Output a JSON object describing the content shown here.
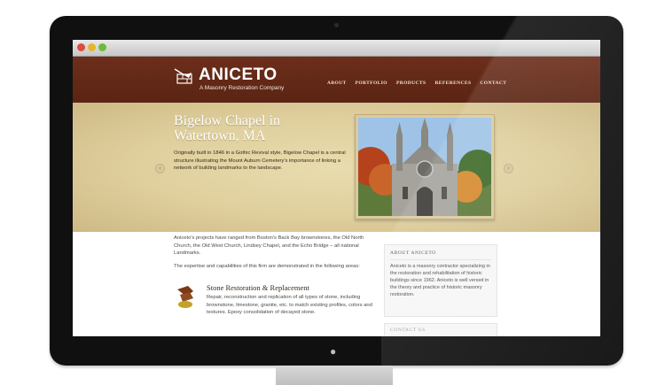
{
  "site": {
    "logo_title": "ANICETO",
    "logo_subtitle": "A Masonry Restoration Company"
  },
  "nav": [
    "ABOUT",
    "PORTFOLIO",
    "PRODUCTS",
    "REFERENCES",
    "CONTACT"
  ],
  "hero": {
    "title": "Bigelow Chapel in Watertown, MA",
    "text": "Originally built in 1846 in a Gothic Revival style, Bigelow Chapel is a central structure illustrating the Mount Auburn Cemetery's importance of linking a network of building landmarks to the landscape.",
    "prev_icon": "chevron-left-icon",
    "next_icon": "chevron-right-icon"
  },
  "content": {
    "intro": "Aniceto's projects have ranged from Boston's Back Bay brownstones, the Old North Church, the Old West Church, Lindsey Chapel, and the Echo Bridge – all national Landmarks.",
    "intro2": "The expertise and capabilities of this firm are demonstrated in the following areas:",
    "service_title": "Stone Restoration & Replacement",
    "service_desc": "Repair, reconstruction and replication of all types of stone, including brownstone, limestone, granite, etc. to match existing profiles, colors and textures. Epoxy consolidation of decayed stone."
  },
  "sidebar": {
    "about_heading": "ABOUT ANICETO",
    "about_text": "Aniceto is a masonry contractor specializing in the restoration and rehabilitation of historic buildings since 1962. Aniceto is well versed in the theory and practice of historic masonry restoration.",
    "contact_heading": "CONTACT US"
  },
  "colors": {
    "header_brown": "#5d2614",
    "hero_parchment": "#e3d4a4"
  }
}
